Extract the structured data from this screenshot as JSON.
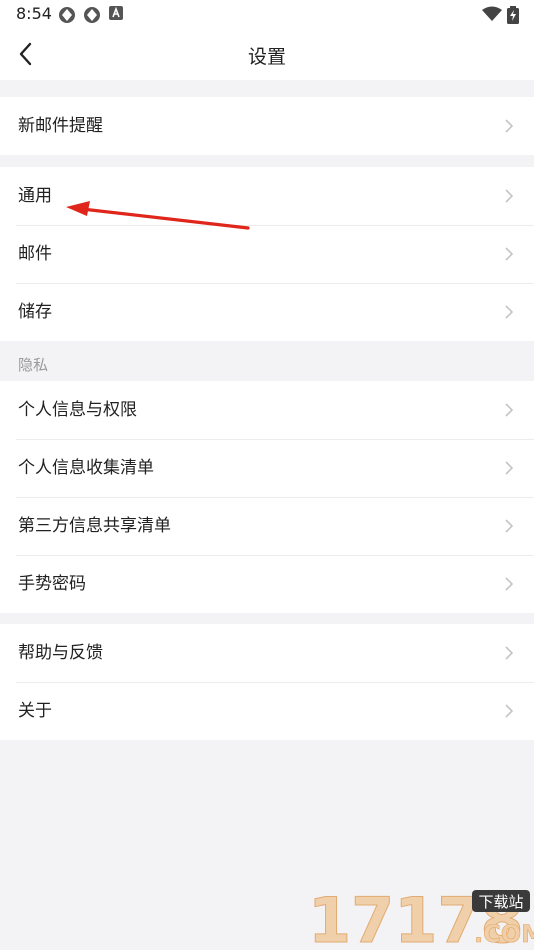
{
  "status": {
    "time": "8:54",
    "icons": [
      "app-icon-1",
      "app-icon-2",
      "a-notification-icon",
      "wifi-icon",
      "battery-icon"
    ]
  },
  "header": {
    "title": "设置",
    "back_icon": "chevron-left-icon"
  },
  "groups": [
    {
      "items": [
        {
          "label": "新邮件提醒"
        }
      ]
    },
    {
      "items": [
        {
          "label": "通用"
        },
        {
          "label": "邮件"
        },
        {
          "label": "储存"
        }
      ]
    },
    {
      "section_label": "隐私",
      "items": [
        {
          "label": "个人信息与权限"
        },
        {
          "label": "个人信息收集清单"
        },
        {
          "label": "第三方信息共享清单"
        },
        {
          "label": "手势密码"
        }
      ]
    },
    {
      "items": [
        {
          "label": "帮助与反馈"
        },
        {
          "label": "关于"
        }
      ]
    }
  ],
  "annotation": {
    "arrow_color": "#e0251b",
    "points_to": "通用"
  },
  "watermark": {
    "logo_text": "17178",
    "badge": "下载站",
    "suffix": ".COM"
  },
  "colors": {
    "background": "#f3f3f5",
    "row_background": "#ffffff",
    "text": "#222222",
    "section_label": "#9a9a9a",
    "chevron": "#c4c4c4"
  }
}
